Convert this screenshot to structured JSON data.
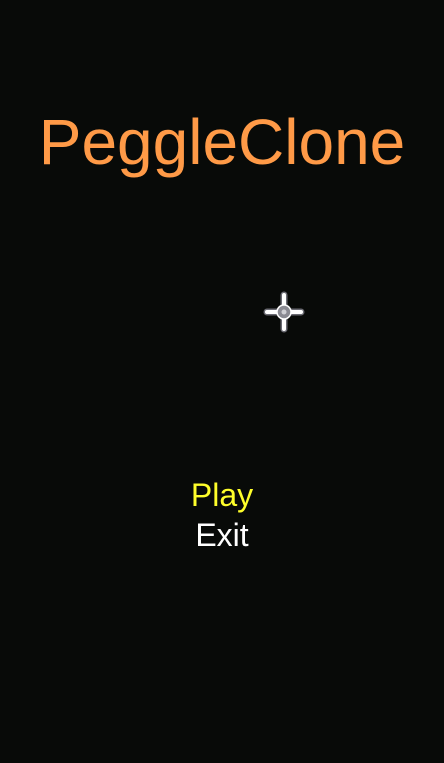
{
  "game": {
    "title": "PeggleClone",
    "menu": {
      "items": [
        {
          "label": "Play",
          "state": "selected"
        },
        {
          "label": "Exit",
          "state": "normal"
        }
      ]
    },
    "colors": {
      "background": "#080a08",
      "title": "#ff9a47",
      "menu_selected": "#fefe2a",
      "menu_normal": "#ffffff"
    },
    "cursor_icon": "crosshair-move-icon"
  }
}
